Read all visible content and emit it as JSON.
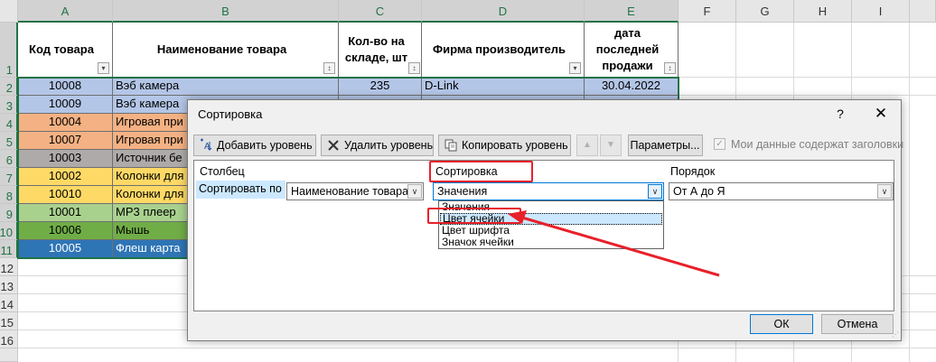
{
  "sheet": {
    "columns": [
      "A",
      "B",
      "C",
      "D",
      "E",
      "F",
      "G",
      "H",
      "I"
    ],
    "rows": [
      "1",
      "2",
      "3",
      "4",
      "5",
      "6",
      "7",
      "8",
      "9",
      "10",
      "11",
      "12",
      "13",
      "14",
      "15",
      "16"
    ],
    "headers": {
      "code": "Код товара",
      "name": "Наименование товара",
      "qty": "Кол-во на складе, шт",
      "maker": "Фирма производитель",
      "date": "дата последней продажи"
    },
    "data_rows": [
      {
        "code": "10008",
        "name": "Вэб камера",
        "qty": "235",
        "maker": "D-Link",
        "date": "30.04.2022",
        "color": "#b4c6e7"
      },
      {
        "code": "10009",
        "name": "Вэб камера",
        "color": "#b4c6e7"
      },
      {
        "code": "10004",
        "name": "Игровая при",
        "color": "#f4b183"
      },
      {
        "code": "10007",
        "name": "Игровая при",
        "color": "#f4b183"
      },
      {
        "code": "10003",
        "name": "Источник бе",
        "color": "#aeaaaa"
      },
      {
        "code": "10002",
        "name": "Колонки для",
        "color": "#ffd966"
      },
      {
        "code": "10010",
        "name": "Колонки для",
        "color": "#ffd966"
      },
      {
        "code": "10001",
        "name": "MP3 плеер",
        "color": "#a9d18e"
      },
      {
        "code": "10006",
        "name": "Мышь",
        "color": "#70ad47"
      },
      {
        "code": "10005",
        "name": "Флеш карта",
        "color": "#2e75b6"
      }
    ]
  },
  "dialog": {
    "title": "Сортировка",
    "help": "?",
    "close": "✕",
    "toolbar": {
      "add_level": "Добавить уровень",
      "delete_level": "Удалить уровень",
      "copy_level": "Копировать уровень",
      "options": "Параметры...",
      "has_headers": "Мои данные содержат заголовки",
      "has_headers_checked": true
    },
    "columns": {
      "column": "Столбец",
      "sort_on": "Сортировка",
      "order": "Порядок"
    },
    "level": {
      "label": "Сортировать по",
      "column_value": "Наименование товара",
      "sort_on_value": "Значения",
      "order_value": "От А до Я"
    },
    "sort_on_options": [
      "Значения",
      "Цвет ячейки",
      "Цвет шрифта",
      "Значок ячейки"
    ],
    "selected_option": "Цвет ячейки",
    "ok": "ОК",
    "cancel": "Отмена"
  },
  "colors": {
    "excel_green": "#217346",
    "annotation_red": "#e8202a",
    "selection_blue": "#cce8ff"
  }
}
